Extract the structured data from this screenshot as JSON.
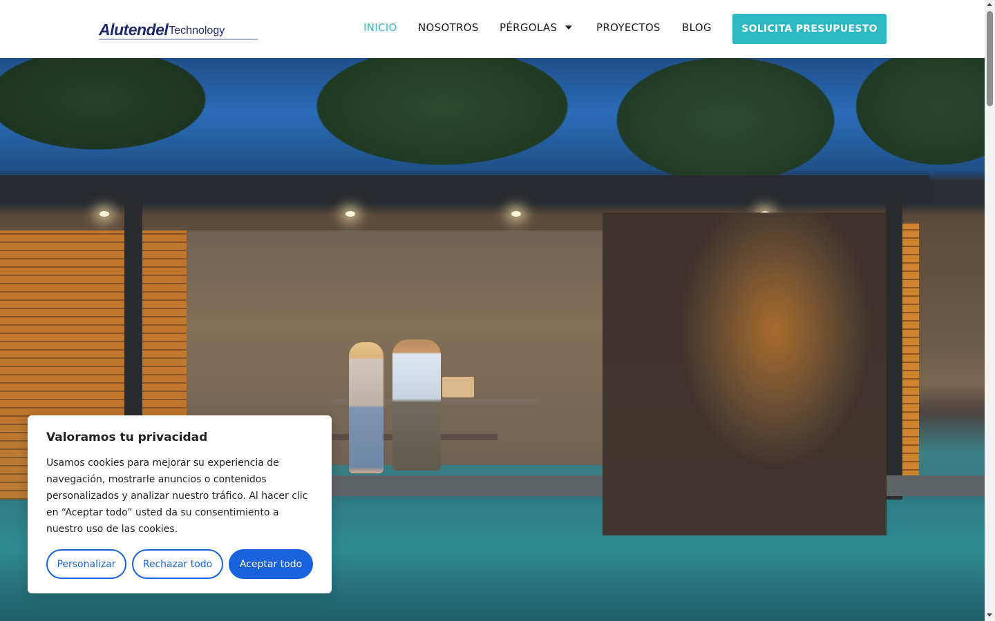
{
  "header": {
    "logo": {
      "brand": "Alutendel",
      "suffix": "Technology",
      "icon": "alutendel-logo"
    },
    "nav": [
      {
        "label": "INICIO",
        "active": true
      },
      {
        "label": "NOSOTROS",
        "active": false
      },
      {
        "label": "PÉRGOLAS",
        "active": false,
        "dropdown": true,
        "icon": "caret-down-icon"
      },
      {
        "label": "PROYECTOS",
        "active": false
      },
      {
        "label": "BLOG",
        "active": false
      }
    ],
    "cta_label": "SOLICITA PRESUPUESTO"
  },
  "colors": {
    "accent": "#2bb8c3",
    "nav_active": "#3ab4c4",
    "cookie_primary": "#1863dc",
    "logo": "#1e2a6b"
  },
  "cookie_banner": {
    "title": "Valoramos tu privacidad",
    "text": "Usamos cookies para mejorar su experiencia de navegación, mostrarle anuncios o contenidos personalizados y analizar nuestro tráfico. Al hacer clic en “Aceptar todo” usted da su consentimiento a nuestro uso de las cookies.",
    "buttons": {
      "customize": "Personalizar",
      "reject": "Rechazar todo",
      "accept": "Aceptar todo"
    }
  }
}
